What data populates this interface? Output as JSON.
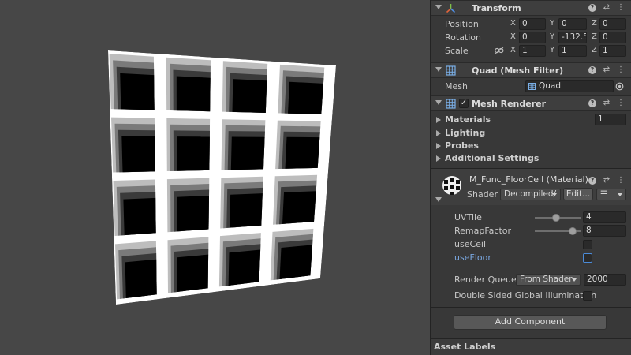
{
  "transform": {
    "title": "Transform",
    "rows": [
      {
        "label": "Position",
        "x": "0",
        "y": "0",
        "z": "0"
      },
      {
        "label": "Rotation",
        "x": "0",
        "y": "-132.5",
        "z": "0"
      },
      {
        "label": "Scale",
        "x": "1",
        "y": "1",
        "z": "1"
      }
    ],
    "axis_x": "X",
    "axis_y": "Y",
    "axis_z": "Z"
  },
  "mesh_filter": {
    "title": "Quad (Mesh Filter)",
    "mesh_label": "Mesh",
    "mesh_value": "Quad"
  },
  "mesh_renderer": {
    "title": "Mesh Renderer",
    "enabled": true,
    "materials_label": "Materials",
    "materials_count": "1",
    "lighting_label": "Lighting",
    "probes_label": "Probes",
    "additional_label": "Additional Settings"
  },
  "material": {
    "title": "M_Func_FloorCeil (Material)",
    "shader_label": "Shader",
    "shader_value": "Decompiled/",
    "edit_label": "Edit...",
    "props": {
      "uvtile_label": "UVTile",
      "uvtile_value": "4",
      "uvtile_slider": 0.46,
      "remap_label": "RemapFactor",
      "remap_value": "8",
      "remap_slider": 0.82,
      "useceil_label": "useCeil",
      "usefloor_label": "useFloor"
    },
    "render_queue_label": "Render Queue",
    "render_queue_mode": "From Shader",
    "render_queue_value": "2000",
    "dsgi_label": "Double Sided Global Illumination"
  },
  "add_component_label": "Add Component",
  "asset_labels": "Asset Labels",
  "colors": {
    "scene_bg": "#474747",
    "inspector_bg": "#383838",
    "accent_blue": "#4b8bd9"
  }
}
